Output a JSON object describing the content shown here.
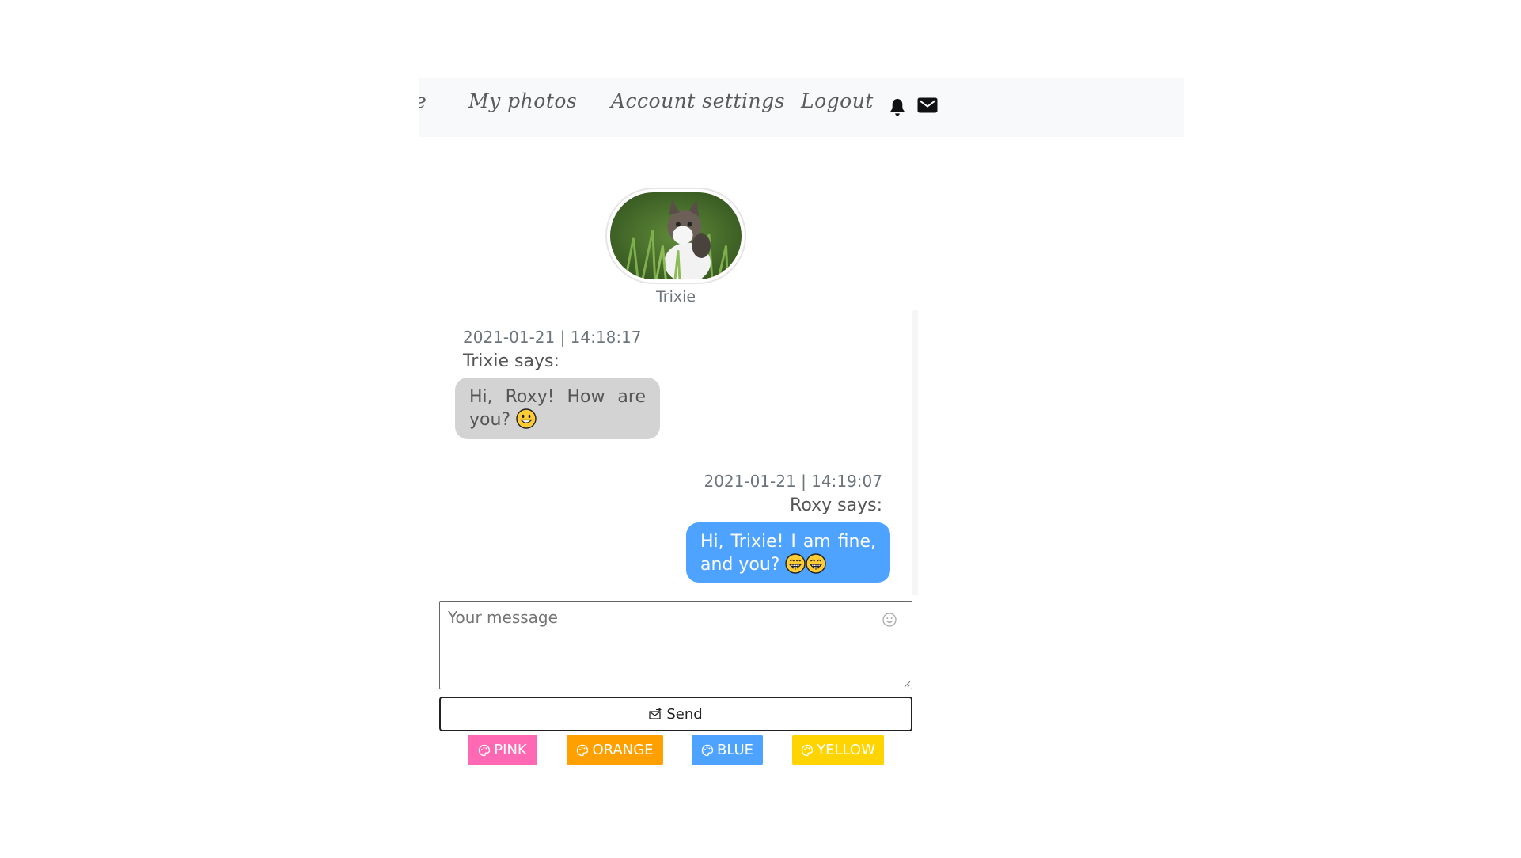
{
  "nav": {
    "cut_item": "e",
    "my_photos": "My photos",
    "account_settings": "Account settings",
    "logout": "Logout",
    "icons": [
      "bell-icon",
      "envelope-icon"
    ]
  },
  "profile": {
    "name": "Trixie"
  },
  "messages": [
    {
      "timestamp": "2021-01-21 | 14:18:17",
      "sender_line": "Trixie says:",
      "text": "Hi, Roxy! How are you?",
      "emoji": [
        "grinning-face"
      ],
      "side": "left",
      "bubble_color": "#d3d3d3"
    },
    {
      "timestamp": "2021-01-21 | 14:19:07",
      "sender_line": "Roxy says:",
      "text": "Hi, Trixie! I am fine, and you?",
      "emoji": [
        "grinning-face-with-smiling-eyes",
        "grinning-face-with-smiling-eyes"
      ],
      "side": "right",
      "bubble_color": "#4da3ff"
    }
  ],
  "composer": {
    "placeholder": "Your message",
    "value": "",
    "send_label": "Send"
  },
  "themes": [
    {
      "label": "PINK",
      "color": "#ff69b4"
    },
    {
      "label": "ORANGE",
      "color": "#ffa000"
    },
    {
      "label": "BLUE",
      "color": "#4da3ff"
    },
    {
      "label": "YELLOW",
      "color": "#ffd400"
    }
  ]
}
